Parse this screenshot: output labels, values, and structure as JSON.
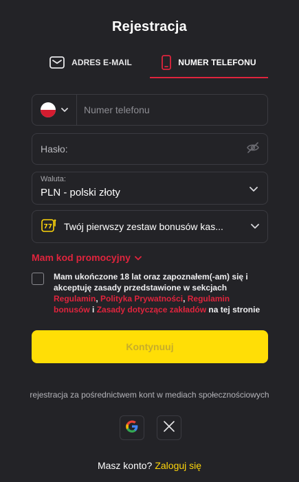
{
  "header": {
    "title": "Rejestracja"
  },
  "tabs": [
    {
      "label": "ADRES E-MAIL",
      "icon": "envelope-icon"
    },
    {
      "label": "NUMER TELEFONU",
      "icon": "mobile-phone-icon",
      "active": true
    }
  ],
  "form": {
    "country_flag": "poland-flag-icon",
    "phone_placeholder": "Numer telefonu",
    "password_label": "Hasło:",
    "currency_label": "Waluta:",
    "currency_value": "PLN - polski złoty",
    "bonus_text": "Twój pierwszy zestaw bonusów kas...",
    "promo_label": "Mam kod promocyjny",
    "terms": {
      "part1": "Mam ukończone 18 lat oraz zapoznałem(-am) się i akceptuję zasady przedstawione w sekcjach ",
      "link1": "Regulamin",
      "sep1": ", ",
      "link2": "Polityka Prywatności",
      "sep2": ", ",
      "link3": "Regulamin bonusów",
      "sep3": " i ",
      "link4": "Zasady dotyczące zakładów",
      "part2": " na tej stronie"
    },
    "continue_label": "Kontynuuj"
  },
  "social": {
    "caption": "rejestracja za pośrednictwem kont w mediach społecznościowych",
    "buttons": [
      "google-icon",
      "x-icon"
    ]
  },
  "footer": {
    "question": "Masz konto?",
    "login_link": "Zaloguj się"
  },
  "colors": {
    "background": "#232327",
    "accent_red": "#e0243d",
    "button_yellow": "#ffde06",
    "link_yellow": "#ffd60a"
  }
}
